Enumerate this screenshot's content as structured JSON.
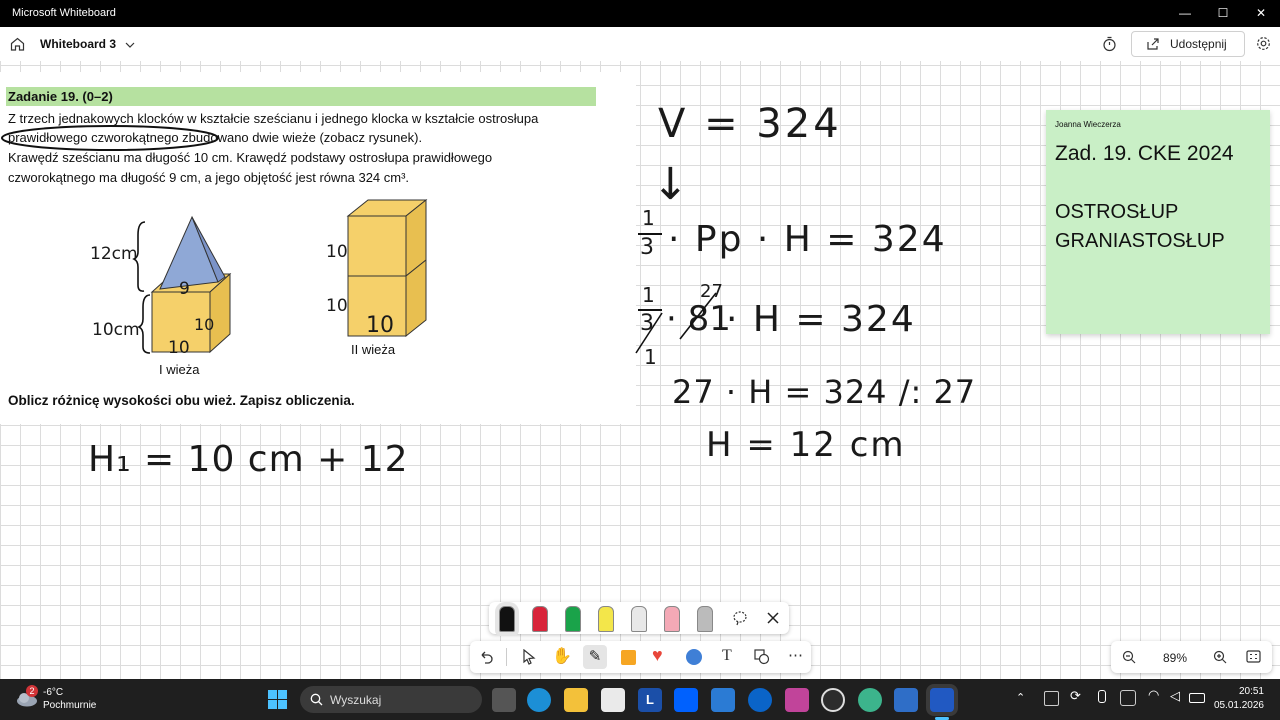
{
  "window": {
    "title": "Microsoft Whiteboard",
    "minimize": "—",
    "maximize": "☐",
    "close": "✕"
  },
  "appbar": {
    "board_name": "Whiteboard 3",
    "share_label": "Udostępnij"
  },
  "task": {
    "heading": "Zadanie 19. (0–2)",
    "line1": "Z trzech jednakowych klocków w kształcie sześcianu i jednego klocka w kształcie ostrosłupa",
    "line2": "prawidłowego czworokątnego zbudowano dwie wieże (zobacz rysunek).",
    "line3": "Krawędź sześcianu ma długość  10 cm. Krawędź podstawy ostrosłupa prawidłowego",
    "line4": "czworokątnego ma długość  9 cm, a jego objętość jest równa  324 cm³.",
    "tower1_label": "I wieża",
    "tower2_label": "II wieża",
    "question": "Oblicz różnicę wysokości obu wież. Zapisz obliczenia."
  },
  "drawing_labels": {
    "t1_height_top": "12cm",
    "t1_height_bottom": "10cm",
    "t1_front": "10",
    "t1_side": "10",
    "t1_pyramid_base": "9",
    "t2_top": "10",
    "t2_bottom": "10",
    "t2_front": "10"
  },
  "handwriting": {
    "h1": "H₁ = 10 cm + 12",
    "v": "V = 324",
    "arrow": "↓",
    "eq1_frac_num": "1",
    "eq1_frac_den": "3",
    "eq1_rest": "· Pp · H = 324",
    "eq2_num": "1",
    "eq2_den": "3",
    "eq2_81": "· 81",
    "eq2_27": "27",
    "eq2_one": "1",
    "eq2_rest": "· H = 324",
    "eq3": "27 · H = 324 /: 27",
    "eq4": "H = 12 cm"
  },
  "note": {
    "author": "Joanna Wieczerza",
    "line1": "Zad. 19.  CKE 2024",
    "line2": "OSTROSŁUP",
    "line3": "GRANIASTOSŁUP",
    "bg_color": "#c9efc6"
  },
  "pens": [
    {
      "name": "black",
      "color": "#111111"
    },
    {
      "name": "red",
      "color": "#d8243a"
    },
    {
      "name": "green",
      "color": "#1aa34a"
    },
    {
      "name": "yellow",
      "color": "#f3e64a"
    },
    {
      "name": "eraser-white",
      "color": "#e8e8e8"
    },
    {
      "name": "eraser-pink",
      "color": "#f4a9b6"
    },
    {
      "name": "ruler",
      "color": "#bbbbbb"
    }
  ],
  "zoom": {
    "level": "89%"
  },
  "taskbar": {
    "temp": "-6°C",
    "weather": "Pochmurnie",
    "weather_badge": "2",
    "search_placeholder": "Wyszukaj",
    "time": "20:51",
    "date": "05.01.2026"
  }
}
